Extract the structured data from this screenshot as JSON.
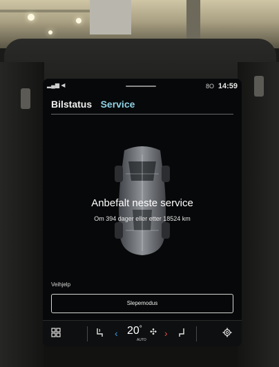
{
  "statusbar": {
    "signal": "▂▄▆ ◀",
    "network_icon": "8O",
    "time": "14:59"
  },
  "tabs": [
    {
      "label": "Bilstatus",
      "active": false
    },
    {
      "label": "Service",
      "active": true
    }
  ],
  "service": {
    "title": "Anbefalt neste service",
    "subtitle": "Om 394 dager eller etter 18524 km"
  },
  "assistance": {
    "label": "Veihjelp",
    "tow_button": "Slepemodus"
  },
  "climate": {
    "temperature": "20",
    "unit": "°",
    "mode": "AUTO",
    "left_arrow": "‹",
    "right_arrow": "›"
  },
  "icons": {
    "apps": "apps-grid-icon",
    "seat_heat_left": "seat-heat-icon",
    "fan": "fan-icon",
    "seat_right": "seat-icon",
    "settings": "gear-icon"
  },
  "colors": {
    "accent_tab": "#8fd3e6",
    "temp_down": "#3a9ef0",
    "temp_up": "#e05050",
    "screen_bg": "#070809"
  }
}
